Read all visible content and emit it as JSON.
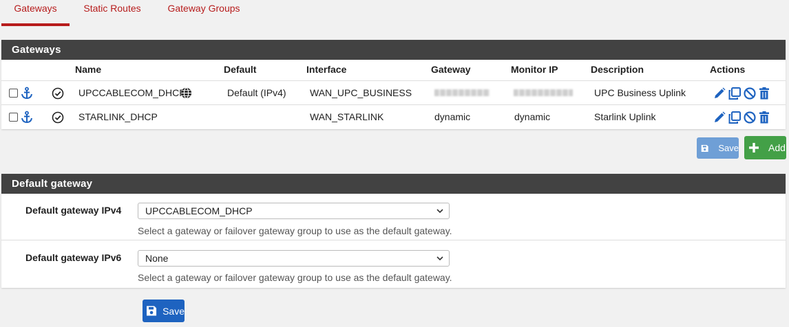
{
  "tabs": [
    {
      "label": "Gateways"
    },
    {
      "label": "Static Routes"
    },
    {
      "label": "Gateway Groups"
    }
  ],
  "gateways_panel": {
    "title": "Gateways",
    "columns": [
      "Name",
      "Default",
      "Interface",
      "Gateway",
      "Monitor IP",
      "Description",
      "Actions"
    ],
    "rows": [
      {
        "name": "UPCCABLECOM_DHCP",
        "default": "Default (IPv4)",
        "interface": "WAN_UPC_BUSINESS",
        "gateway": "",
        "monitor_ip": "",
        "description": "UPC Business Uplink"
      },
      {
        "name": "STARLINK_DHCP",
        "default": "",
        "interface": "WAN_STARLINK",
        "gateway": "dynamic",
        "monitor_ip": "dynamic",
        "description": "Starlink Uplink"
      }
    ],
    "save_label": "Save",
    "add_label": "Add"
  },
  "default_gateway_panel": {
    "title": "Default gateway",
    "ipv4": {
      "label": "Default gateway IPv4",
      "value": "UPCCABLECOM_DHCP",
      "help": "Select a gateway or failover gateway group to use as the default gateway."
    },
    "ipv6": {
      "label": "Default gateway IPv6",
      "value": "None",
      "help": "Select a gateway or failover gateway group to use as the default gateway."
    }
  },
  "save_button_label": "Save",
  "colors": {
    "accent": "#b71c1c",
    "panel_heading": "#424242",
    "action_icon": "#1e63c0",
    "add_button": "#43a047"
  },
  "icons": [
    "anchor-icon",
    "check-circle-icon",
    "globe-icon",
    "pencil-icon",
    "copy-icon",
    "disable-icon",
    "trash-icon",
    "save-icon",
    "plus-icon",
    "chevron-down-icon"
  ]
}
